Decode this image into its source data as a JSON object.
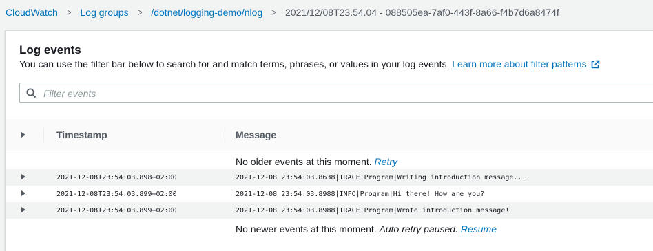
{
  "breadcrumb": {
    "items": [
      "CloudWatch",
      "Log groups",
      "/dotnet/logging-demo/nlog"
    ],
    "current": "2021/12/08T23.54.04 - 088505ea-7af0-443f-8a66-f4b7d6a8474f",
    "separator": ">"
  },
  "panel": {
    "title": "Log events",
    "description": "You can use the filter bar below to search for and match terms, phrases, or values in your log events.",
    "learn_more": "Learn more about filter patterns"
  },
  "filter": {
    "placeholder": "Filter events"
  },
  "table": {
    "columns": {
      "timestamp": "Timestamp",
      "message": "Message"
    },
    "older_text": "No older events at this moment.",
    "retry": "Retry",
    "newer_text": "No newer events at this moment.",
    "auto_retry": "Auto retry paused.",
    "resume": "Resume",
    "events": [
      {
        "timestamp": "2021-12-08T23:54:03.898+02:00",
        "message": "2021-12-08 23:54:03.8638|TRACE|Program|Writing introduction message..."
      },
      {
        "timestamp": "2021-12-08T23:54:03.899+02:00",
        "message": "2021-12-08 23:54:03.8988|INFO|Program|Hi there! How are you?"
      },
      {
        "timestamp": "2021-12-08T23:54:03.899+02:00",
        "message": "2021-12-08 23:54:03.8988|TRACE|Program|Wrote introduction message!"
      }
    ]
  },
  "colors": {
    "link": "#0073bb",
    "text": "#16191f",
    "muted": "#545b64",
    "background": "#f2f3f3"
  },
  "icons": {
    "search": "search-icon",
    "external": "external-link-icon",
    "expand": "caret-right-icon"
  }
}
